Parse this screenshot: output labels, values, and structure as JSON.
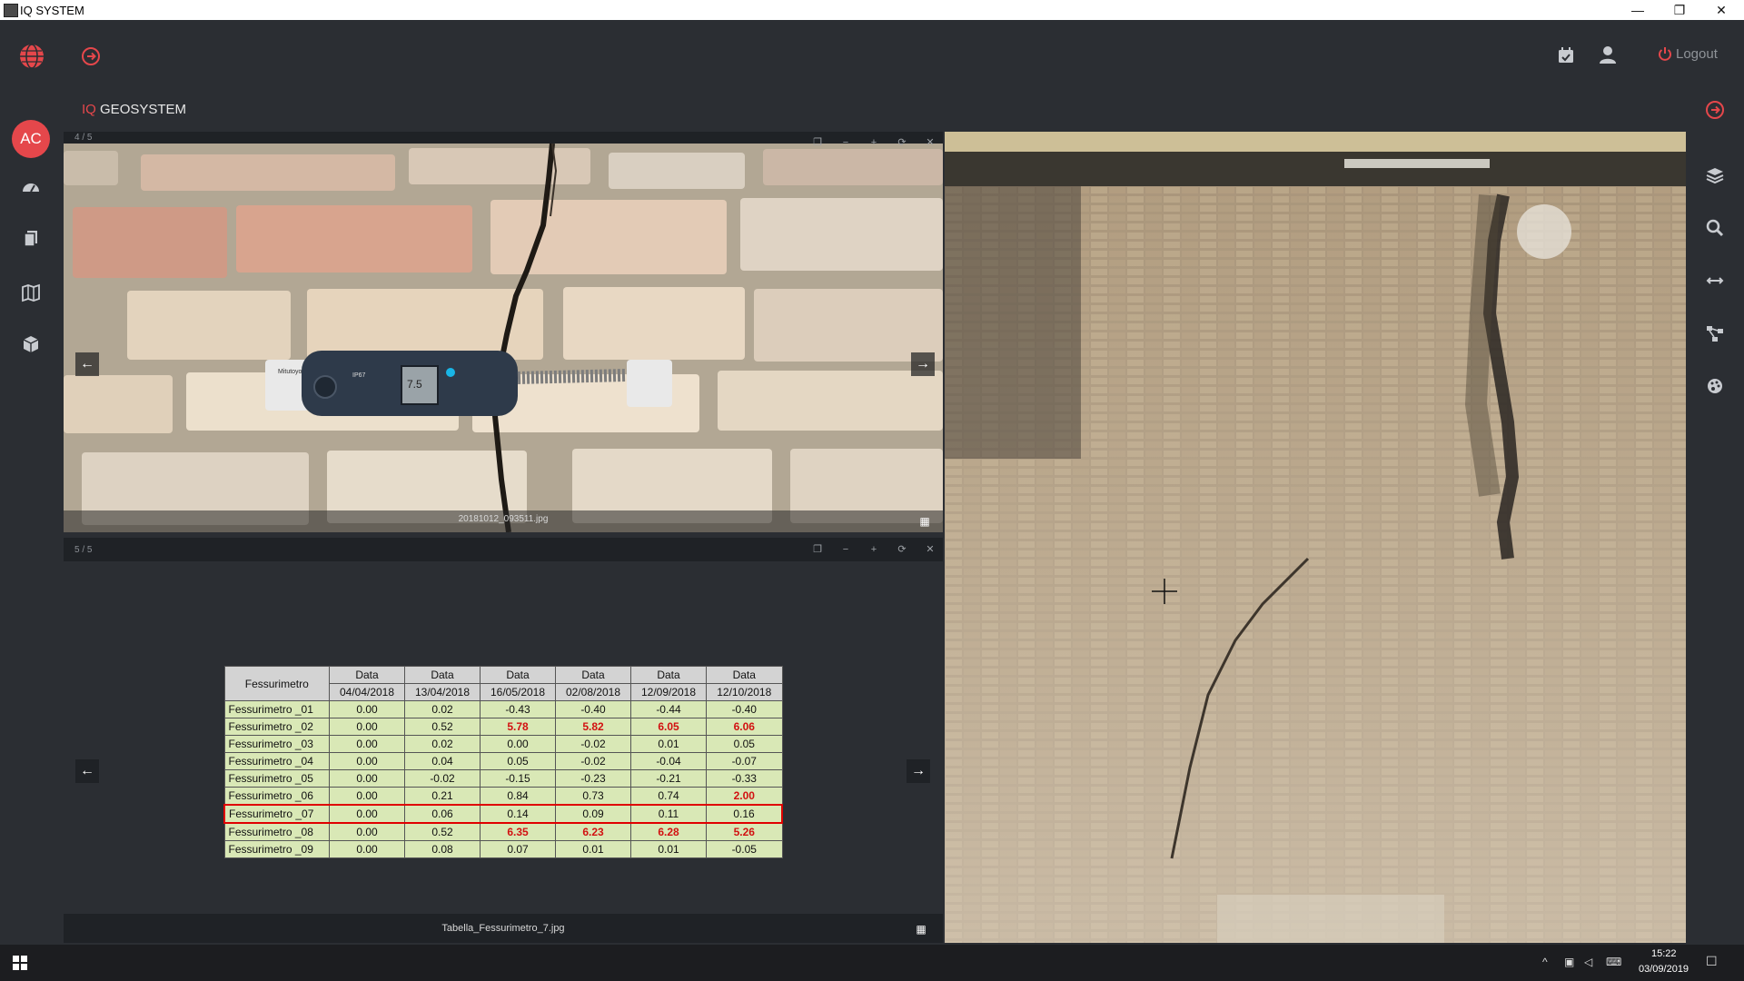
{
  "window": {
    "title": "IQ SYSTEM",
    "minimize": "—",
    "restore": "❐",
    "close": "✕"
  },
  "header": {
    "logout_label": "Logout",
    "brand_prefix": "IQ",
    "brand_name": "GEOSYSTEM",
    "avatar_initials": "AC"
  },
  "colors": {
    "accent": "#e5474b",
    "bg": "#2b2e33",
    "panel": "#1f2226"
  },
  "viewer_top": {
    "counter": "4 / 5",
    "filename": "20181012_093511.jpg",
    "prev": "←",
    "next": "→"
  },
  "viewer_bottom": {
    "counter": "5 / 5",
    "filename": "Tabella_Fessurimetro_7.jpg",
    "prev": "←",
    "next": "→",
    "table": {
      "first_header": "Fessurimetro",
      "date_label": "Data",
      "dates": [
        "04/04/2018",
        "13/04/2018",
        "16/05/2018",
        "02/08/2018",
        "12/09/2018",
        "12/10/2018"
      ],
      "rows": [
        {
          "name": "Fessurimetro _01",
          "values": [
            "0.00",
            "0.02",
            "-0.43",
            "-0.40",
            "-0.44",
            "-0.40"
          ],
          "highlight": []
        },
        {
          "name": "Fessurimetro _02",
          "values": [
            "0.00",
            "0.52",
            "5.78",
            "5.82",
            "6.05",
            "6.06"
          ],
          "highlight": [
            2,
            3,
            4,
            5
          ]
        },
        {
          "name": "Fessurimetro _03",
          "values": [
            "0.00",
            "0.02",
            "0.00",
            "-0.02",
            "0.01",
            "0.05"
          ],
          "highlight": []
        },
        {
          "name": "Fessurimetro _04",
          "values": [
            "0.00",
            "0.04",
            "0.05",
            "-0.02",
            "-0.04",
            "-0.07"
          ],
          "highlight": []
        },
        {
          "name": "Fessurimetro _05",
          "values": [
            "0.00",
            "-0.02",
            "-0.15",
            "-0.23",
            "-0.21",
            "-0.33"
          ],
          "highlight": []
        },
        {
          "name": "Fessurimetro _06",
          "values": [
            "0.00",
            "0.21",
            "0.84",
            "0.73",
            "0.74",
            "2.00"
          ],
          "highlight": [
            5
          ]
        },
        {
          "name": "Fessurimetro _07",
          "values": [
            "0.00",
            "0.06",
            "0.14",
            "0.09",
            "0.11",
            "0.16"
          ],
          "highlight": [],
          "selected": true
        },
        {
          "name": "Fessurimetro _08",
          "values": [
            "0.00",
            "0.52",
            "6.35",
            "6.23",
            "6.28",
            "5.26"
          ],
          "highlight": [
            2,
            3,
            4,
            5
          ]
        },
        {
          "name": "Fessurimetro _09",
          "values": [
            "0.00",
            "0.08",
            "0.07",
            "0.01",
            "0.01",
            "-0.05"
          ],
          "highlight": []
        }
      ]
    }
  },
  "device": {
    "label1": "Mitutoyo",
    "label2": "IP67",
    "display": "7.5"
  },
  "taskbar": {
    "time": "15:22",
    "date": "03/09/2019"
  },
  "icons": {
    "globe": "globe-icon",
    "login": "arrow-circle-icon",
    "calendar": "calendar-icon",
    "user": "user-icon",
    "power": "power-icon",
    "dashboard": "gauge-icon",
    "docs": "documents-icon",
    "map": "map-icon",
    "cube": "cube-icon",
    "layers": "layers-icon",
    "search": "search-icon",
    "measure": "measure-icon",
    "network": "network-icon",
    "palette": "palette-icon"
  }
}
